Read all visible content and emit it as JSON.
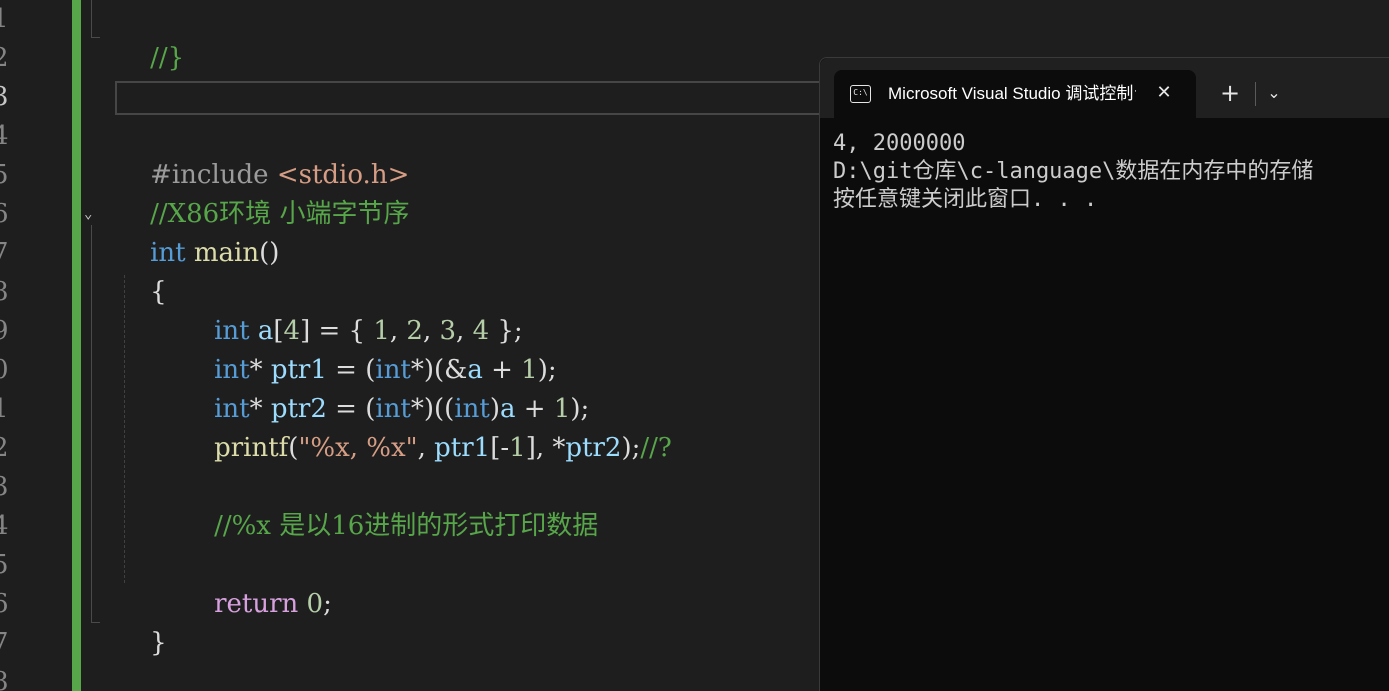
{
  "editor": {
    "line_numbers": [
      "1",
      "2",
      "3",
      "4",
      "5",
      "6",
      "7",
      "8",
      "9",
      "0",
      "1",
      "2",
      "3",
      "4",
      "5",
      "6",
      "7",
      "8"
    ],
    "current_line_index": 2,
    "fold_icon": "chevron-down-icon",
    "lines": {
      "l1": {
        "t1": "//}"
      },
      "l4": {
        "t1": "#include ",
        "t2": "<stdio.h>"
      },
      "l5": {
        "t1": "//X86环境 小端字节序"
      },
      "l6": {
        "t1": "int",
        "t2": " ",
        "t3": "main",
        "t4": "()"
      },
      "l7": {
        "t1": "{"
      },
      "l8": {
        "t1": "int",
        "t2": " ",
        "t3": "a",
        "t4": "[",
        "t5": "4",
        "t6": "] = { ",
        "t7": "1",
        "t8": ", ",
        "t9": "2",
        "t10": ", ",
        "t11": "3",
        "t12": ", ",
        "t13": "4",
        "t14": " };"
      },
      "l9": {
        "t1": "int",
        "t2": "* ",
        "t3": "ptr1",
        "t4": " = (",
        "t5": "int",
        "t6": "*)(&",
        "t7": "a",
        "t8": " + ",
        "t9": "1",
        "t10": ");"
      },
      "l10": {
        "t1": "int",
        "t2": "* ",
        "t3": "ptr2",
        "t4": " = (",
        "t5": "int",
        "t6": "*)((",
        "t7": "int",
        "t8": ")",
        "t9": "a",
        "t10": " + ",
        "t11": "1",
        "t12": ");"
      },
      "l11": {
        "t1": "printf",
        "t2": "(",
        "t3": "\"%x, %x\"",
        "t4": ", ",
        "t5": "ptr1",
        "t6": "[-",
        "t7": "1",
        "t8": "], *",
        "t9": "ptr2",
        "t10": ");",
        "t11": "//?"
      },
      "l13": {
        "t1": "//%x 是以16进制的形式打印数据"
      },
      "l15": {
        "t1": "return",
        "t2": " ",
        "t3": "0",
        "t4": ";"
      },
      "l16": {
        "t1": "}"
      }
    }
  },
  "terminal": {
    "tab_icon_text": "C:\\",
    "tab_title": "Microsoft Visual Studio 调试控制台",
    "close_glyph": "✕",
    "new_tab_glyph": "+",
    "dropdown_glyph": "⌄",
    "output": [
      "4, 2000000",
      "D:\\git仓库\\c-language\\数据在内存中的存储",
      "按任意键关闭此窗口. . ."
    ]
  }
}
